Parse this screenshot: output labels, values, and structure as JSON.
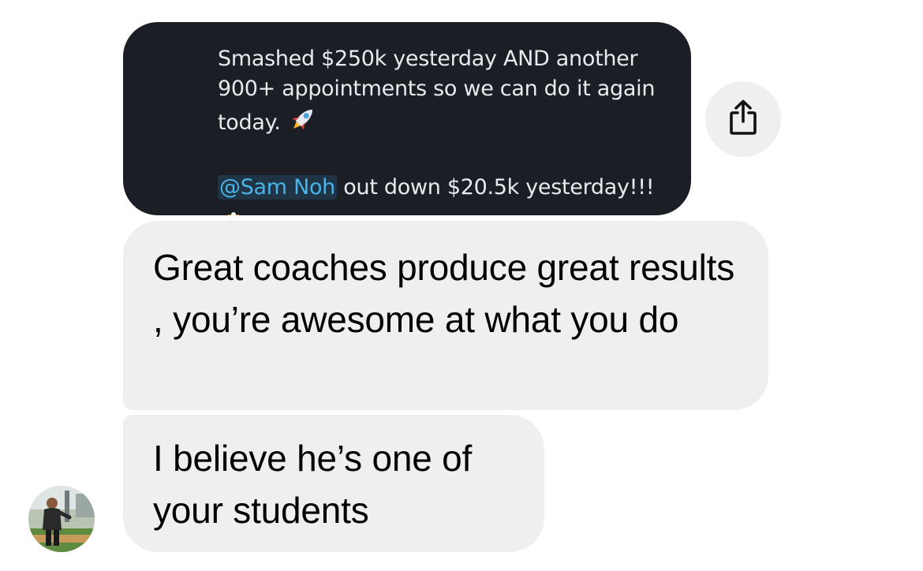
{
  "shared_post": {
    "line1": "Smashed $250k yesterday AND another",
    "line2": "900+ appointments so we can do it again",
    "line3": "today.",
    "mention": "@Sam Noh",
    "line4_rest": " out down $20.5k yesterday!!!",
    "emoji_1": "rocket-emoji",
    "emoji_2": "exploding-head-emoji"
  },
  "share_button": {
    "icon": "share-icon"
  },
  "messages": [
    {
      "text": "Great coaches produce great results , you’re awesome at what you do"
    },
    {
      "text": "I believe he’s one of your students"
    }
  ],
  "avatar": {
    "icon": "user-avatar"
  },
  "colors": {
    "card_bg": "#1b1e24",
    "card_text": "#e9eaec",
    "mention": "#4ab3e8",
    "bubble_bg": "#efefef",
    "share_bg": "#efefef"
  }
}
